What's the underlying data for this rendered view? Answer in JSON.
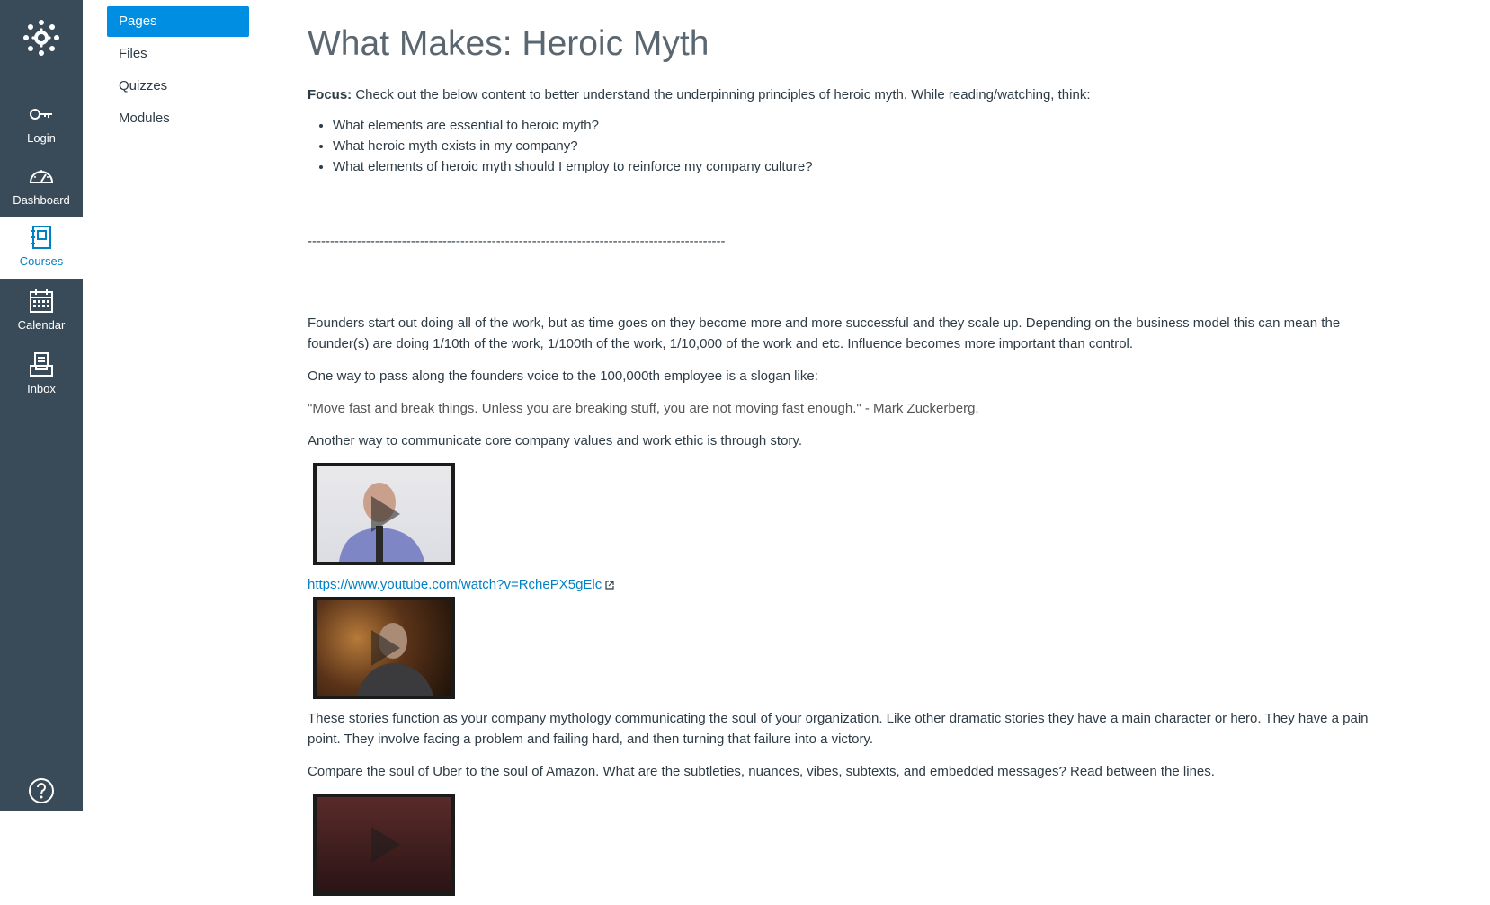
{
  "global_nav": {
    "items": [
      {
        "label": "Login",
        "icon": "key-icon"
      },
      {
        "label": "Dashboard",
        "icon": "speedometer-icon"
      },
      {
        "label": "Courses",
        "icon": "book-icon"
      },
      {
        "label": "Calendar",
        "icon": "calendar-icon"
      },
      {
        "label": "Inbox",
        "icon": "inbox-icon"
      }
    ],
    "active": "Courses",
    "colors": {
      "background": "#394b58",
      "active_text": "#0081c6"
    }
  },
  "course_nav": {
    "items": [
      {
        "label": "Pages"
      },
      {
        "label": "Files"
      },
      {
        "label": "Quizzes"
      },
      {
        "label": "Modules"
      }
    ],
    "active": "Pages",
    "accent": "#008ee2"
  },
  "page": {
    "title": "What Makes: Heroic Myth",
    "focus_label": "Focus:",
    "focus_text": " Check out the below content to better understand the underpinning principles of heroic myth. While reading/watching, think:",
    "questions": [
      "What elements are essential to heroic myth?",
      "What heroic myth exists in my company?",
      "What elements of heroic myth should I employ to reinforce my company culture?"
    ],
    "divider": "---------------------------------------------------------------------------------------------",
    "paragraphs": {
      "founders": "Founders start out doing all of the work, but as time goes on they become more and more successful and they scale up.  Depending on the business model this can mean the founder(s) are doing 1/10th of the work, 1/100th of the work, 1/10,000 of the work and etc.  Influence becomes more important than control.",
      "slogan": "One way to pass along the founders voice to the 100,000th employee is a slogan like:",
      "quote": "\"Move fast and break things. Unless you are breaking stuff, you are not moving fast enough.\" - Mark Zuckerberg.",
      "story": "Another way to communicate core company values and work ethic is through story.",
      "mythology": "These stories function as your company mythology communicating the soul of your organization. Like other dramatic stories they have a main character or hero.  They have a pain point.  They involve facing a problem and failing hard, and then turning that failure into a victory.",
      "compare": "Compare the soul of Uber to the soul of Amazon. What are the subtleties, nuances, vibes, subtexts, and embedded messages?  Read between the lines."
    },
    "video_link": "https://www.youtube.com/watch?v=RchePX5gElc",
    "link_color": "#0081c6"
  }
}
